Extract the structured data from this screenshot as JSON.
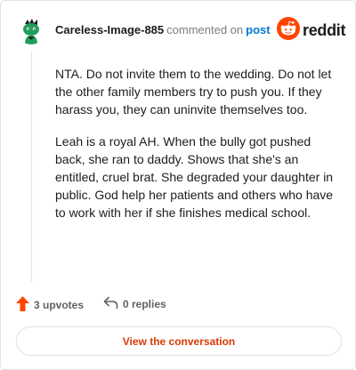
{
  "header": {
    "author": "Careless-Image-885",
    "commented_text": "commented on",
    "post_link": "post",
    "brand": "reddit"
  },
  "icons": {
    "avatar": "snoo-avatar-icon",
    "brand": "reddit-logo-icon",
    "upvote": "upvote-arrow-icon",
    "reply": "reply-arrow-icon"
  },
  "colors": {
    "brand_orange": "#ff4500",
    "link_blue": "#0079d3",
    "cta_text": "#d93900",
    "avatar_green": "#1e9e5b"
  },
  "comment": {
    "paragraphs": [
      "NTA. Do not invite them to the wedding. Do not let the other family members try to push you. If they harass you, they can uninvite themselves too.",
      "Leah is a royal AH. When the bully got pushed back, she ran to daddy. Shows that she's an entitled, cruel brat. She degraded your daughter in public. God help her patients and others who have to work with her if she finishes medical school."
    ]
  },
  "actions": {
    "upvotes_label": "3 upvotes",
    "replies_label": "0 replies"
  },
  "cta": {
    "label": "View the conversation"
  }
}
